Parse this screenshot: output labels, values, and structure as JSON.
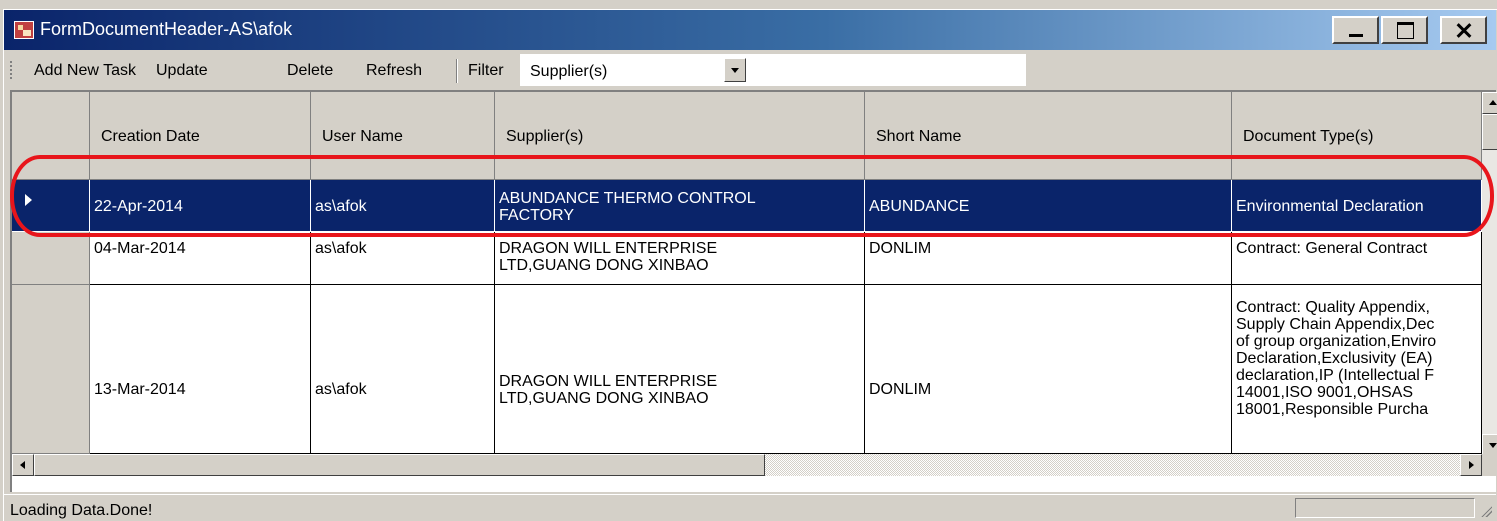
{
  "window": {
    "title": "FormDocumentHeader-AS\\afok"
  },
  "toolbar": {
    "add_new_task": "Add New Task",
    "update": "Update",
    "delete": "Delete",
    "refresh": "Refresh",
    "filter_label": "Filter",
    "filter_value": "Supplier(s)"
  },
  "grid": {
    "columns": [
      "Creation Date",
      "User Name",
      "Supplier(s)",
      "Short Name",
      "Document Type(s)"
    ],
    "rows": [
      {
        "creation_date": "22-Apr-2014",
        "user_name": "as\\afok",
        "supplier": "ABUNDANCE THERMO CONTROL\nFACTORY",
        "short_name": "ABUNDANCE",
        "document_types": "Environmental Declaration",
        "selected": true
      },
      {
        "creation_date": "04-Mar-2014",
        "user_name": "as\\afok",
        "supplier": "DRAGON WILL ENTERPRISE\nLTD,GUANG DONG XINBAO",
        "short_name": "DONLIM",
        "document_types": "Contract: General Contract"
      },
      {
        "creation_date": "13-Mar-2014",
        "user_name": "as\\afok",
        "supplier": "DRAGON WILL ENTERPRISE\nLTD,GUANG DONG XINBAO",
        "short_name": "DONLIM",
        "document_types": "Contract: Quality Appendix,\nSupply Chain Appendix,Dec\nof group organization,Enviro\nDeclaration,Exclusivity (EA)\ndeclaration,IP (Intellectual F\n14001,ISO 9001,OHSAS\n18001,Responsible Purcha"
      }
    ]
  },
  "status": {
    "text": "Loading Data.Done!"
  },
  "colors": {
    "title_bar": "#0a246a",
    "selection": "#0a246a",
    "highlight_annotation": "#e8151b",
    "window_face": "#d4d0c8"
  }
}
